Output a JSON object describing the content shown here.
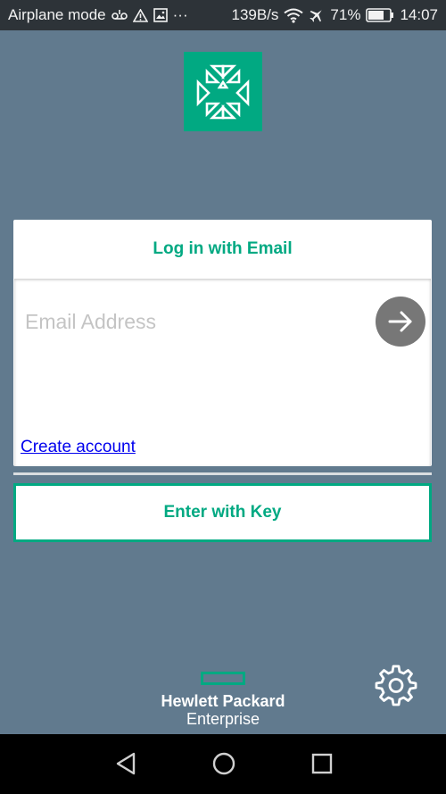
{
  "status_bar": {
    "mode": "Airplane mode",
    "more": "···",
    "speed": "139B/s",
    "battery": "71%",
    "time": "14:07",
    "icons": [
      "voicemail-icon",
      "warning-icon",
      "image-icon",
      "wifi-icon",
      "airplane-icon",
      "battery-icon"
    ]
  },
  "login": {
    "title": "Log in with Email",
    "email_placeholder": "Email Address",
    "email_value": "",
    "create_account": "Create account",
    "enter_key": "Enter with Key"
  },
  "brand": {
    "line1": "Hewlett Packard",
    "line2": "Enterprise",
    "accent": "#01a982",
    "background": "#617a8e"
  },
  "nav": {
    "icons": [
      "back-icon",
      "home-icon",
      "recents-icon"
    ]
  }
}
